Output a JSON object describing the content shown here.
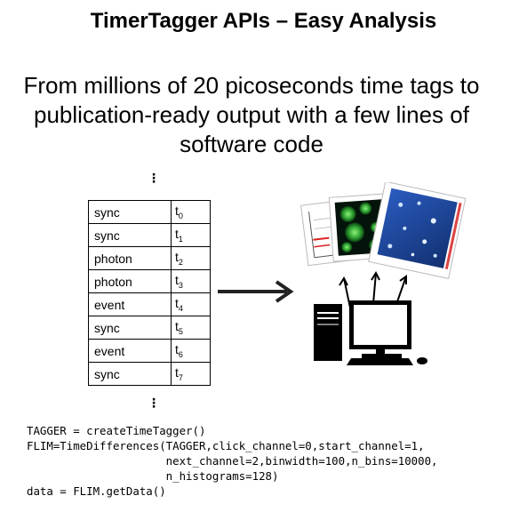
{
  "title": "TimerTagger APIs – Easy Analysis",
  "subtitle": "From millions of 20 picoseconds time tags to publication-ready output with a few lines of software code",
  "vdots": "⋮",
  "rows": [
    {
      "kind": "sync",
      "t": "t",
      "sub": "0"
    },
    {
      "kind": "sync",
      "t": "t",
      "sub": "1"
    },
    {
      "kind": "photon",
      "t": "t",
      "sub": "2"
    },
    {
      "kind": "photon",
      "t": "t",
      "sub": "3"
    },
    {
      "kind": "event",
      "t": "t",
      "sub": "4"
    },
    {
      "kind": "sync",
      "t": "t",
      "sub": "5"
    },
    {
      "kind": "event",
      "t": "t",
      "sub": "6"
    },
    {
      "kind": "sync",
      "t": "t",
      "sub": "7"
    }
  ],
  "code_lines": [
    "TAGGER = createTimeTagger()",
    "FLIM=TimeDifferences(TAGGER,click_channel=0,start_channel=1,",
    "                     next_channel=2,binwidth=100,n_bins=10000,",
    "                     n_histograms=128)",
    "data = FLIM.getData()"
  ],
  "colors": {
    "text": "#000000",
    "flim_green": "#1f8a2a",
    "heatmap_blue": "#1b3e8f"
  },
  "icons": [
    "arrow-right-icon",
    "computer-icon",
    "chart-thumbnail-icon",
    "flim-image-icon",
    "heatmap-icon"
  ]
}
